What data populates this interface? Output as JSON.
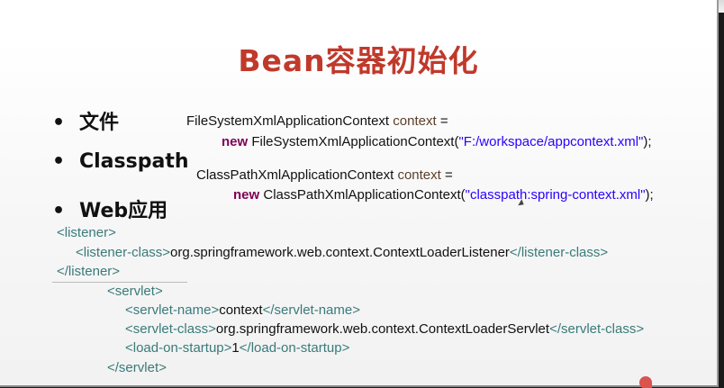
{
  "slide": {
    "title": "Bean容器初始化",
    "bullets": [
      "文件",
      "Classpath",
      "Web应用"
    ],
    "bullet_glyph": "•",
    "file_code": {
      "line1_type": "FileSystemXmlApplicationContext",
      "line1_var": "context",
      "line1_eq": "=",
      "line2_kw": "new",
      "line2_call": "FileSystemXmlApplicationContext(",
      "line2_str": "\"F:/workspace/appcontext.xml\"",
      "line2_end": ");"
    },
    "classpath_code": {
      "line1_type": "ClassPathXmlApplicationContext",
      "line1_var": "context",
      "line1_eq": "=",
      "line2_kw": "new",
      "line2_call": "ClassPathXmlApplicationContext(",
      "line2_str": "\"classpath:spring-context.xml\"",
      "line2_end": ");"
    },
    "web_xml": {
      "listener_open": "<listener>",
      "listener_class_open": "<listener-class>",
      "listener_class_value": "org.springframework.web.context.ContextLoaderListener",
      "listener_class_close": "</listener-class>",
      "listener_close": "</listener>",
      "servlet_open": "<servlet>",
      "servlet_name_open": "<servlet-name>",
      "servlet_name_value": "context",
      "servlet_name_close": "</servlet-name>",
      "servlet_class_open": "<servlet-class>",
      "servlet_class_value": "org.springframework.web.context.ContextLoaderServlet",
      "servlet_class_close": "</servlet-class>",
      "load_open": "<load-on-startup>",
      "load_value": "1",
      "load_close": "</load-on-startup>",
      "servlet_close": "</servlet>"
    },
    "colors": {
      "title": "#c0392b",
      "keyword": "#7f0055",
      "string": "#2a00ff",
      "xml_tag": "#3a7a7a"
    }
  }
}
